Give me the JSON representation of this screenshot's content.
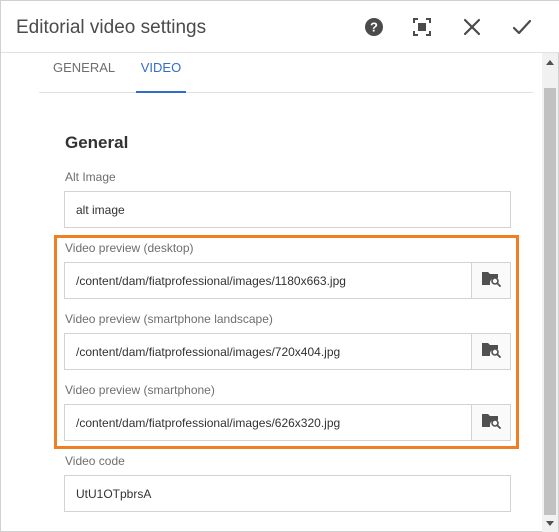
{
  "dialog": {
    "title": "Editorial video settings"
  },
  "header": {
    "help_icon": "help-circle-icon",
    "fullscreen_icon": "fullscreen-icon",
    "close_icon": "close-icon",
    "done_icon": "checkmark-icon"
  },
  "tabs": [
    {
      "label": "GENERAL",
      "active": false
    },
    {
      "label": "VIDEO",
      "active": true
    }
  ],
  "section": {
    "title": "General"
  },
  "fields": {
    "alt_image": {
      "label": "Alt Image",
      "value": "alt image"
    },
    "preview_desktop": {
      "label": "Video preview (desktop)",
      "value": "/content/dam/fiatprofessional/images/1180x663.jpg"
    },
    "preview_landscape": {
      "label": "Video preview (smartphone landscape)",
      "value": "/content/dam/fiatprofessional/images/720x404.jpg"
    },
    "preview_smartphone": {
      "label": "Video preview (smartphone)",
      "value": "/content/dam/fiatprofessional/images/626x320.jpg"
    },
    "video_code": {
      "label": "Video code",
      "value": "UtU1OTpbrsA"
    }
  },
  "colors": {
    "accent": "#326ec8",
    "highlight": "#f07f24"
  }
}
